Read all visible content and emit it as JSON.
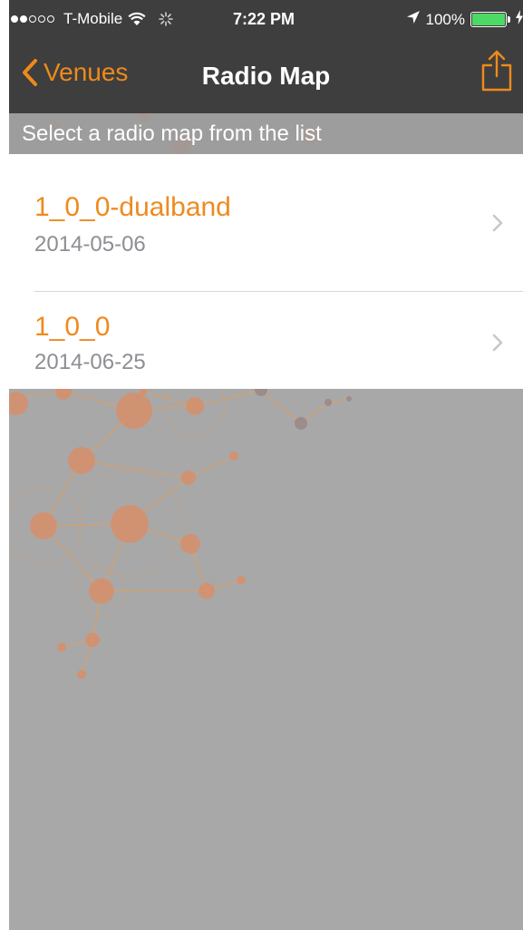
{
  "status_bar": {
    "carrier": "T-Mobile",
    "time": "7:22 PM",
    "battery": "100%",
    "signal_bars_filled": 2,
    "signal_bars_total": 5
  },
  "nav": {
    "back_label": "Venues",
    "title": "Radio Map"
  },
  "subtitle": "Select a radio map from the list",
  "radio_maps": [
    {
      "name": "1_0_0-dualband",
      "date": "2014-05-06"
    },
    {
      "name": "1_0_0",
      "date": "2014-06-25"
    }
  ],
  "colors": {
    "accent": "#ef8a1a",
    "nav_bg": "#3e3e3e",
    "background": "#a8a8a8",
    "date_text": "#8e8e93",
    "battery": "#4cd964"
  },
  "icons": {
    "back": "chevron-left-icon",
    "share": "share-icon",
    "row_disclosure": "chevron-right-icon",
    "wifi": "wifi-icon",
    "activity": "activity-spinner-icon",
    "location": "location-arrow-icon",
    "battery": "battery-icon",
    "charging": "charging-bolt-icon"
  }
}
